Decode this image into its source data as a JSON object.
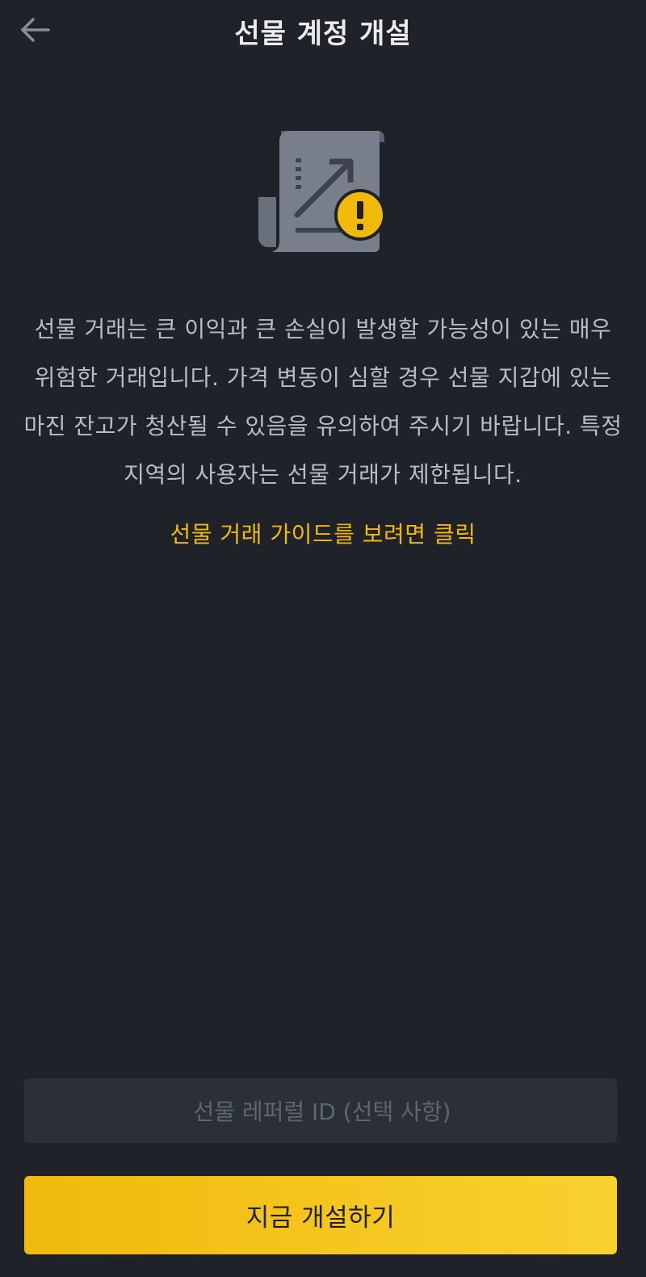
{
  "header": {
    "back_icon": "arrow-left-icon",
    "title": "선물 계정 개설"
  },
  "illustration": {
    "icon": "futures-document-warning-icon",
    "badge_symbol": "!",
    "badge_color": "#f0b90b",
    "document_color": "#787f8a"
  },
  "main": {
    "description": "선물 거래는 큰 이익과 큰 손실이 발생할 가능성이 있는 매우 위험한 거래입니다. 가격 변동이 심할 경우 선물 지갑에 있는 마진 잔고가 청산될 수 있음을 유의하여 주시기 바랍니다. 특정 지역의 사용자는 선물 거래가 제한됩니다.",
    "guide_link": "선물 거래 가이드를 보려면 클릭"
  },
  "referral": {
    "placeholder": "선물 레퍼럴 ID (선택 사항)",
    "value": ""
  },
  "actions": {
    "open_now_label": "지금 개설하기"
  },
  "colors": {
    "background": "#1f2229",
    "accent": "#f0b90b",
    "input_background": "#2b2f36",
    "text_secondary": "#b7bdc6"
  }
}
